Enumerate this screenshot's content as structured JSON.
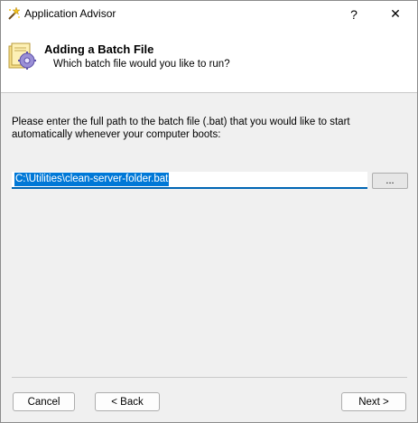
{
  "window": {
    "title": "Application Advisor",
    "help_label": "?",
    "close_label": "✕"
  },
  "header": {
    "title": "Adding a Batch File",
    "subtitle": "Which batch file would you like to run?"
  },
  "main": {
    "instructions": "Please enter the full path to the batch file (.bat) that you would like to start automatically whenever your computer boots:",
    "path_value": "C:\\Utilities\\clean-server-folder.bat",
    "browse_label": "..."
  },
  "footer": {
    "cancel_label": "Cancel",
    "back_label": "< Back",
    "next_label": "Next >"
  },
  "colors": {
    "selection": "#0078d7",
    "input_underline": "#0066b4"
  },
  "icons": {
    "app": "wizard-wand-icon",
    "header": "batch-file-gear-icon",
    "help": "help-icon",
    "close": "close-icon"
  }
}
